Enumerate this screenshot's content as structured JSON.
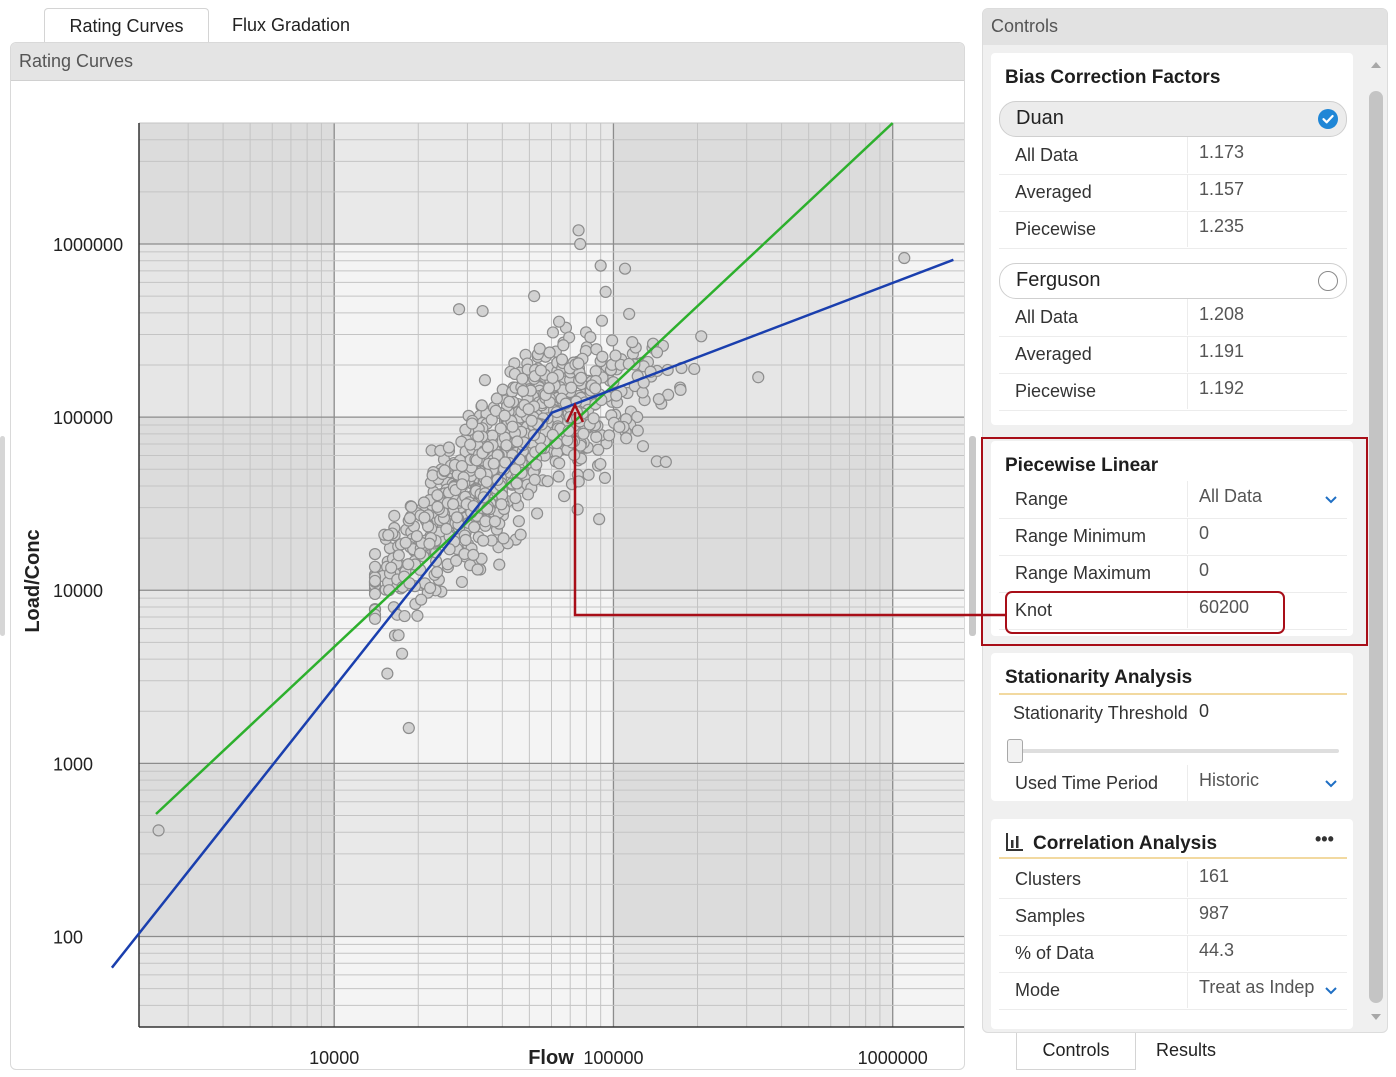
{
  "tabs": [
    {
      "label": "Rating Curves",
      "active": true
    },
    {
      "label": "Flux Gradation",
      "active": false
    }
  ],
  "chart_panel": {
    "title": "Rating Curves"
  },
  "chart_data": {
    "type": "scatter",
    "xlabel": "Flow",
    "ylabel": "Load/Conc",
    "x_scale": "log",
    "y_scale": "log",
    "xlim": [
      2000,
      1800000
    ],
    "ylim": [
      30,
      5000000
    ],
    "x_tick_labels": [
      "10000",
      "100000",
      "1000000"
    ],
    "y_tick_labels": [
      "100",
      "1000",
      "10000",
      "100000",
      "1000000"
    ],
    "grid": true,
    "marker_color": "#d2d2d2",
    "series": [
      {
        "name": "",
        "color": "#2db02d",
        "style": "line",
        "points": [
          [
            2300,
            510
          ],
          [
            1000000,
            5000000
          ]
        ]
      },
      {
        "name": "",
        "color": "#1a3fae",
        "style": "line",
        "points": [
          [
            1600,
            66
          ],
          [
            60200,
            106000
          ],
          [
            1650000,
            810000
          ]
        ]
      }
    ],
    "outlier_points": [
      [
        2350,
        410
      ],
      [
        18500,
        1600
      ],
      [
        75000,
        1200000
      ],
      [
        76000,
        1000000
      ],
      [
        90000,
        750000
      ],
      [
        110000,
        720000
      ],
      [
        1100000,
        830000
      ],
      [
        52000,
        500000
      ],
      [
        28000,
        420000
      ],
      [
        34000,
        410000
      ],
      [
        330000,
        170000
      ],
      [
        16000,
        13500
      ],
      [
        17000,
        5500
      ],
      [
        17500,
        4300
      ],
      [
        15500,
        3300
      ]
    ],
    "cloud_sample_count": 987
  },
  "annotation": {
    "arrow_color": "#a80e18",
    "from": "Knot",
    "to_knot_flow": 60200
  },
  "controls": {
    "title": "Controls",
    "bias": {
      "title": "Bias Correction Factors",
      "duan": {
        "label": "Duan",
        "selected": true
      },
      "duan_rows": [
        {
          "label": "All Data",
          "value": "1.173"
        },
        {
          "label": "Averaged",
          "value": "1.157"
        },
        {
          "label": "Piecewise",
          "value": "1.235"
        }
      ],
      "ferguson": {
        "label": "Ferguson",
        "selected": false
      },
      "ferguson_rows": [
        {
          "label": "All Data",
          "value": "1.208"
        },
        {
          "label": "Averaged",
          "value": "1.191"
        },
        {
          "label": "Piecewise",
          "value": "1.192"
        }
      ]
    },
    "piecewise": {
      "title": "Piecewise Linear",
      "rows": [
        {
          "label": "Range",
          "value": "All Data"
        },
        {
          "label": "Range Minimum",
          "value": "0"
        },
        {
          "label": "Range Maximum",
          "value": "0"
        },
        {
          "label": "Knot",
          "value": "60200"
        }
      ]
    },
    "stationarity": {
      "title": "Stationarity Analysis",
      "threshold_label": "Stationarity Threshold",
      "threshold_value": "0",
      "slider_value": 0,
      "time_label": "Used Time Period",
      "time_value": "Historic"
    },
    "correlation": {
      "title": "Correlation Analysis",
      "more": "•••",
      "rows": [
        {
          "label": "Clusters",
          "value": "161"
        },
        {
          "label": "Samples",
          "value": "987"
        },
        {
          "label": "% of Data",
          "value": "44.3"
        },
        {
          "label": "Mode",
          "value": "Treat as Indep"
        }
      ]
    }
  },
  "bottom_tabs": [
    {
      "label": "Controls",
      "active": true
    },
    {
      "label": "Results",
      "active": false
    }
  ]
}
